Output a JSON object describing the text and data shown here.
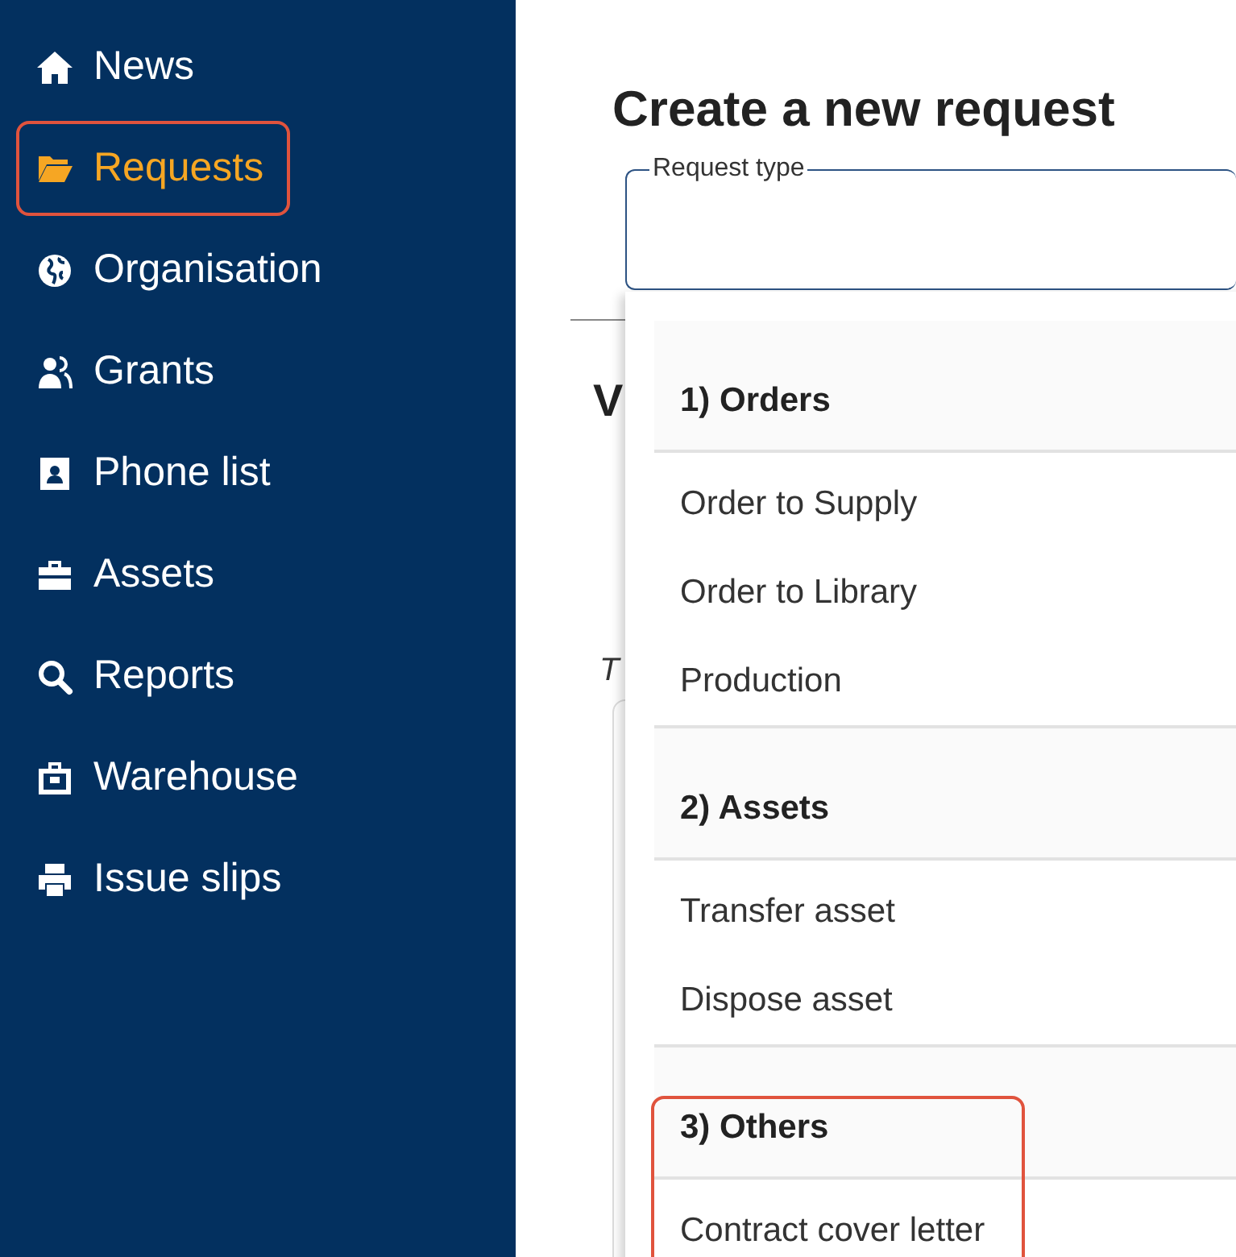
{
  "sidebar": {
    "items": [
      {
        "label": "News",
        "selected": false,
        "highlighted": false
      },
      {
        "label": "Requests",
        "selected": true,
        "highlighted": true
      },
      {
        "label": "Organisation",
        "selected": false,
        "highlighted": false
      },
      {
        "label": "Grants",
        "selected": false,
        "highlighted": false
      },
      {
        "label": "Phone list",
        "selected": false,
        "highlighted": false
      },
      {
        "label": "Assets",
        "selected": false,
        "highlighted": false
      },
      {
        "label": "Reports",
        "selected": false,
        "highlighted": false
      },
      {
        "label": "Warehouse",
        "selected": false,
        "highlighted": false
      },
      {
        "label": "Issue slips",
        "selected": false,
        "highlighted": false
      }
    ]
  },
  "page": {
    "title": "Create a new request",
    "hidden_heading": "V",
    "hidden_text": "T"
  },
  "request_type": {
    "label": "Request type",
    "groups": [
      {
        "header": "1) Orders",
        "highlighted": false,
        "items": [
          "Order to Supply",
          "Order to Library",
          "Production"
        ]
      },
      {
        "header": "2) Assets",
        "highlighted": false,
        "items": [
          "Transfer asset",
          "Dispose asset"
        ]
      },
      {
        "header": "3) Others",
        "highlighted": true,
        "items": [
          "Contract cover letter"
        ]
      }
    ]
  }
}
